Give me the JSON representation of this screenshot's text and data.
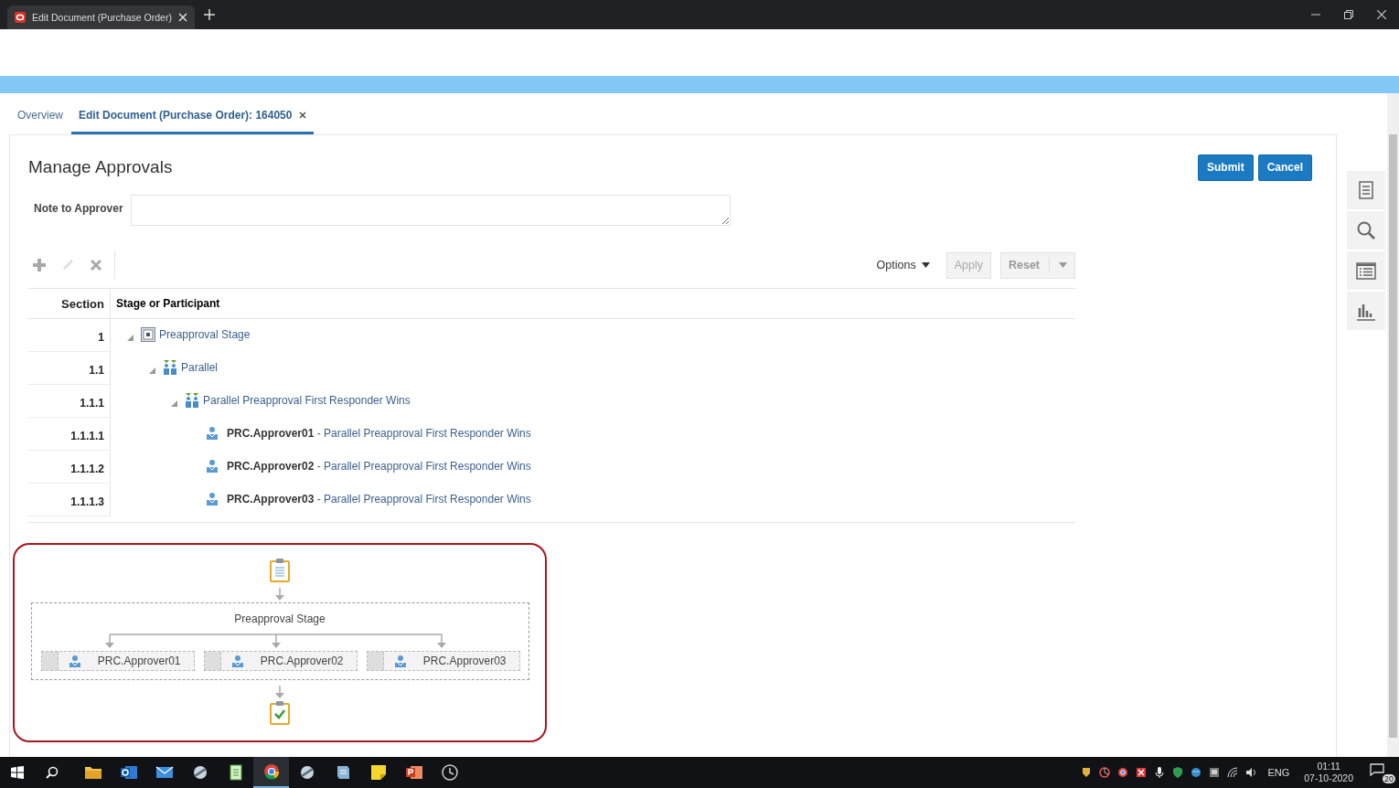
{
  "browser": {
    "tab_title": "Edit Document (Purchase Order)"
  },
  "page_tabs": [
    {
      "label": "Overview",
      "selected": false,
      "closable": false
    },
    {
      "label": "Edit Document (Purchase Order): 164050",
      "selected": true,
      "closable": true
    }
  ],
  "title": "Manage Approvals",
  "buttons": [
    {
      "label": "Submit"
    },
    {
      "label": "Cancel"
    }
  ],
  "note": {
    "label": "Note to Approver"
  },
  "toolbar": {
    "actions": [
      {
        "kind": "add",
        "disabled": false
      },
      {
        "kind": "edit",
        "disabled": true
      },
      {
        "kind": "delete",
        "disabled": false
      }
    ],
    "options": "Options",
    "apply": {
      "label": "Apply",
      "disabled": true
    },
    "reset": "Reset"
  },
  "table": {
    "columns": [
      "Section",
      "Stage or Participant"
    ],
    "rows": [
      {
        "section": "1",
        "label": "Preapproval Stage",
        "kind": "stage",
        "expanded": true,
        "children": [
          {
            "section": "1.1",
            "label": "Parallel",
            "kind": "parallel",
            "expanded": true,
            "children": [
              {
                "section": "1.1.1",
                "label": "Parallel Preapproval First Responder Wins",
                "kind": "parallel",
                "expanded": true,
                "children": [
                  {
                    "section": "1.1.1.1",
                    "label": "**PRC.Approver01** - Parallel Preapproval First Responder Wins",
                    "kind": "participant"
                  },
                  {
                    "section": "1.1.1.2",
                    "label": "**PRC.Approver02** - Parallel Preapproval First Responder Wins",
                    "kind": "participant"
                  },
                  {
                    "section": "1.1.1.3",
                    "label": "**PRC.Approver03** - Parallel Preapproval First Responder Wins",
                    "kind": "participant"
                  }
                ]
              }
            ]
          }
        ]
      }
    ]
  },
  "diagram": {
    "stage": "Preapproval Stage",
    "participants": [
      "PRC.Approver01",
      "PRC.Approver02",
      "PRC.Approver03"
    ]
  },
  "side_rail": [
    {
      "kind": "document"
    },
    {
      "kind": "search"
    },
    {
      "kind": "list"
    },
    {
      "kind": "chart"
    }
  ],
  "taskbar": {
    "apps": [
      {
        "kind": "folder",
        "selected": false
      },
      {
        "kind": "outlook",
        "selected": false
      },
      {
        "kind": "mail",
        "selected": false
      },
      {
        "kind": "tool",
        "selected": false
      },
      {
        "kind": "notepad",
        "selected": false
      },
      {
        "kind": "browser",
        "selected": true
      },
      {
        "kind": "tool",
        "selected": false
      },
      {
        "kind": "note",
        "selected": false
      },
      {
        "kind": "sticky",
        "selected": false
      },
      {
        "kind": "slides",
        "selected": false
      },
      {
        "kind": "clock",
        "selected": false
      }
    ],
    "language": "ENG",
    "time": "01:11",
    "date": "07-10-2020",
    "notifications": "20"
  }
}
